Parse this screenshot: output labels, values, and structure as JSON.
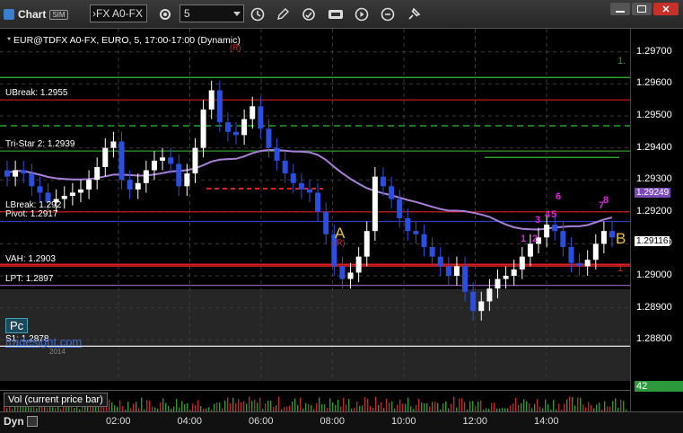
{
  "window": {
    "title": "Chart",
    "sim_badge": "SIM"
  },
  "toolbar": {
    "symbol_value": "›FX A0-FX",
    "period_value": "5",
    "icons": [
      "settings-icon",
      "clock-icon",
      "pencil-icon",
      "cycle-icon",
      "indicator-icon",
      "play-icon",
      "pin-icon"
    ],
    "window_buttons": [
      "minimize",
      "maximize",
      "close"
    ]
  },
  "chart": {
    "header": "* EUR@TDFX A0-FX, EURO, 5, 17:00-17:00 (Dynamic)",
    "levels": [
      {
        "key": "ubreak",
        "label": "UBreak: 1.2955",
        "color": "#d42020"
      },
      {
        "key": "tristar",
        "label": "Tri-Star 2: 1.2939",
        "color": "#2a9a2a"
      },
      {
        "key": "lbreak",
        "label": "LBreak: 1.292",
        "color": "#d42020"
      },
      {
        "key": "pivot",
        "label": "Pivot: 1.2917",
        "color": "#2b3fc0"
      },
      {
        "key": "vah",
        "label": "VAH: 1.2903",
        "color": "#d42020"
      },
      {
        "key": "lpt",
        "label": "LPT: 1.2897",
        "color": "#9a68c8"
      },
      {
        "key": "s1",
        "label": "S1: 1.2878",
        "color": "#ffffff"
      }
    ],
    "annotations": {
      "a": "A",
      "b": "B",
      "r_top": "(R)",
      "r_mid": "(R)",
      "green_right": "1.",
      "red_right": "1",
      "pc": "Pc",
      "watermark": "tradesight.com",
      "watermark_year": "2014"
    },
    "seq_numbers": [
      "1",
      "2",
      "3",
      "4",
      "5",
      "6",
      "7",
      "8"
    ],
    "y_axis": [
      "1.29700",
      "1.29600",
      "1.29500",
      "1.29400",
      "1.29300",
      "1.29200",
      "1.29100",
      "1.29000",
      "1.28900",
      "1.28800"
    ],
    "price_tags": {
      "ma": "1.29249",
      "last": "1.29116"
    },
    "volume": {
      "tab_label": "Vol (current price bar)",
      "last": "42"
    },
    "time_axis": [
      "02:00",
      "04:00",
      "06:00",
      "08:00",
      "10:00",
      "12:00",
      "14:00"
    ],
    "dyn": "Dyn"
  },
  "chart_data": {
    "type": "candlestick",
    "title": "* EUR@TDFX A0-FX, EURO, 5, 17:00-17:00 (Dynamic)",
    "ylim": [
      1.2875,
      1.2975
    ],
    "x_ticks": [
      "02:00",
      "04:00",
      "06:00",
      "08:00",
      "10:00",
      "12:00",
      "14:00"
    ],
    "close_path": [
      1.2931,
      1.2933,
      1.2932,
      1.2928,
      1.2926,
      1.2923,
      1.2924,
      1.2925,
      1.2926,
      1.2927,
      1.293,
      1.2934,
      1.294,
      1.2942,
      1.293,
      1.2927,
      1.2929,
      1.2933,
      1.2936,
      1.2937,
      1.2935,
      1.2928,
      1.2932,
      1.294,
      1.2952,
      1.2958,
      1.2948,
      1.2945,
      1.2944,
      1.2949,
      1.2953,
      1.2946,
      1.294,
      1.2936,
      1.2932,
      1.2929,
      1.2927,
      1.2926,
      1.292,
      1.2913,
      1.2903,
      1.2899,
      1.2901,
      1.2906,
      1.2914,
      1.2931,
      1.2928,
      1.2924,
      1.2918,
      1.2914,
      1.2913,
      1.2909,
      1.2906,
      1.2903,
      1.29,
      1.2903,
      1.2895,
      1.2889,
      1.2892,
      1.2896,
      1.2899,
      1.29,
      1.2902,
      1.2906,
      1.291,
      1.2912,
      1.2916,
      1.2914,
      1.2909,
      1.2904,
      1.2903,
      1.2905,
      1.291,
      1.2914,
      1.2912
    ],
    "moving_average_last": 1.29249,
    "last_price": 1.29116,
    "levels": {
      "UBreak": 1.2955,
      "Tri-Star 2": 1.2939,
      "LBreak": 1.292,
      "Pivot": 1.2917,
      "VAH": 1.2903,
      "LPT": 1.2897,
      "S1": 1.2878
    }
  }
}
